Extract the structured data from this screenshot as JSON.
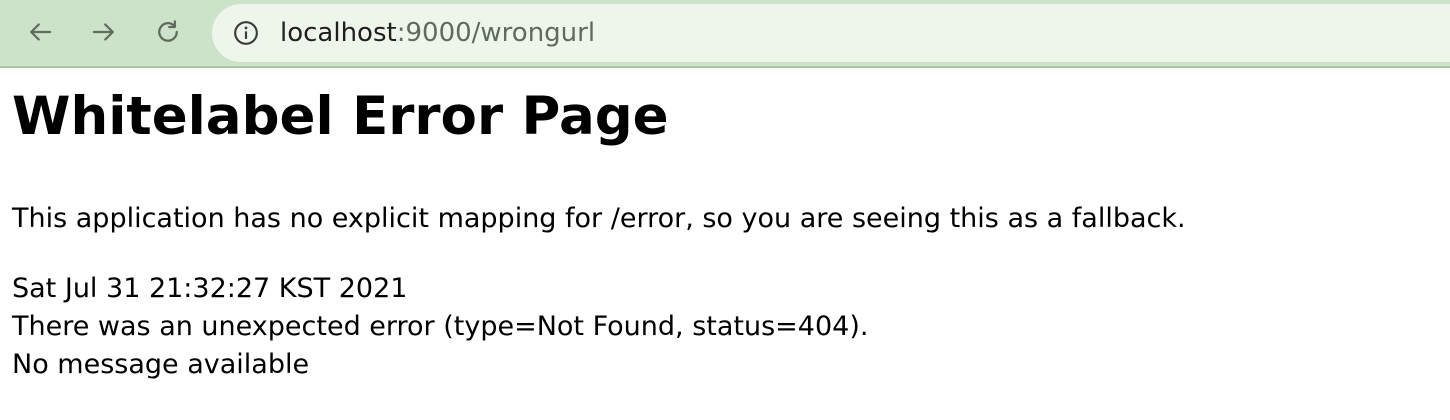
{
  "browser": {
    "url_host": "localhost",
    "url_path": ":9000/wrongurl",
    "icons": {
      "back": "arrow-left-icon",
      "forward": "arrow-right-icon",
      "reload": "reload-icon",
      "site_info": "info-icon"
    },
    "colors": {
      "toolbar": "#cde3c9",
      "omnibox": "#eef6ec",
      "icon": "#5f6b5c"
    }
  },
  "page": {
    "title": "Whitelabel Error Page",
    "description": "This application has no explicit mapping for /error, so you are seeing this as a fallback.",
    "timestamp": "Sat Jul 31 21:32:27 KST 2021",
    "error_line": "There was an unexpected error (type=Not Found, status=404).",
    "message": "No message available"
  }
}
